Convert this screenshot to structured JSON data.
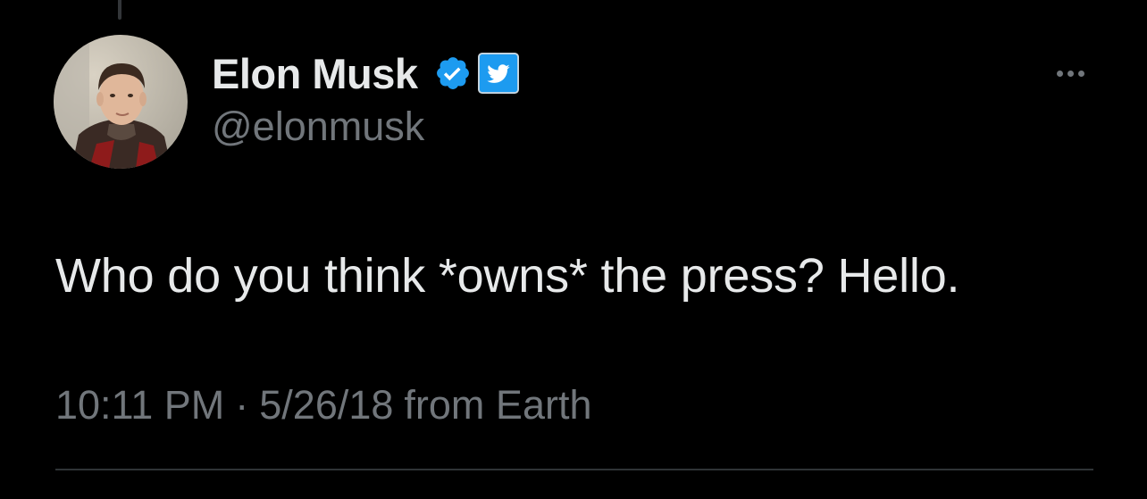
{
  "tweet": {
    "author": {
      "display_name": "Elon Musk",
      "handle": "@elonmusk",
      "avatar_icon": "profile-photo"
    },
    "badges": {
      "verified_icon": "verified-check-icon",
      "affiliate_icon": "twitter-bird-icon"
    },
    "more_icon": "more-dots-icon",
    "text": "Who do you think *owns* the press? Hello.",
    "time": "10:11 PM",
    "separator": "·",
    "date": "5/26/18",
    "source": "from Earth"
  },
  "colors": {
    "background": "#000000",
    "primary_text": "#e7e9ea",
    "secondary_text": "#71767b",
    "verified_blue": "#1d9bf0",
    "divider": "#2f3336"
  }
}
